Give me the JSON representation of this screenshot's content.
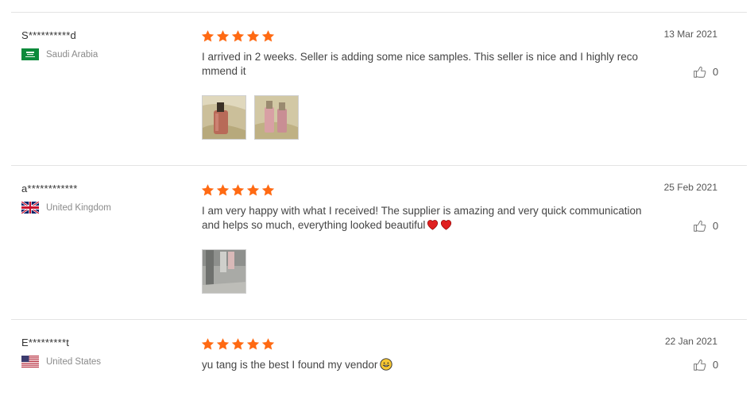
{
  "reviews": [
    {
      "user": "S**********d",
      "country": "Saudi Arabia",
      "flag_icon": "saudi-arabia-flag-icon",
      "stars": 5,
      "text": "I arrived in 2 weeks. Seller is adding some nice samples. This seller is nice and I highly recommend it",
      "date": "13 Mar 2021",
      "likes": "0",
      "photos": 2
    },
    {
      "user": "a************",
      "country": "United Kingdom",
      "flag_icon": "united-kingdom-flag-icon",
      "stars": 5,
      "text": "I am very happy with what I received! The supplier is amazing and very quick communication and helps so much, everything looked beautiful",
      "date": "25 Feb 2021",
      "likes": "0",
      "photos": 1
    },
    {
      "user": "E*********t",
      "country": "United States",
      "flag_icon": "united-states-flag-icon",
      "stars": 5,
      "text": "yu tang is the best I found my vendor",
      "date": "22 Jan 2021",
      "likes": "0",
      "photos": 0
    }
  ],
  "colors": {
    "star": "#ff6a13",
    "heart": "#e02020",
    "text": "#444444",
    "date": "#555555",
    "divider": "#e3e3e3"
  }
}
